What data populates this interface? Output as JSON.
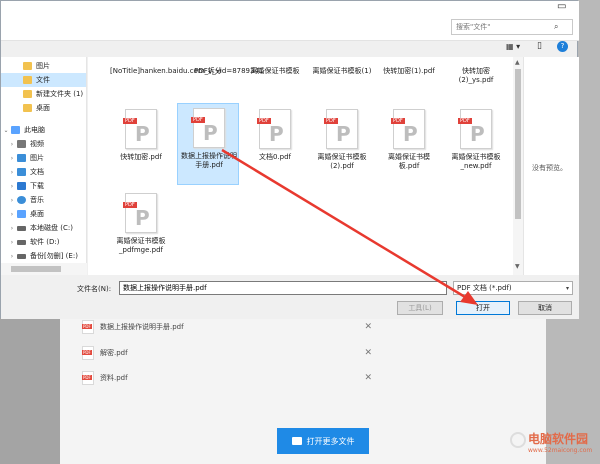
{
  "dialog": {
    "search_placeholder": "搜索\"文件\"",
    "nav": [
      {
        "label": "图片",
        "icon": "folder-icon"
      },
      {
        "label": "文件",
        "icon": "folder-icon",
        "selected": true
      },
      {
        "label": "新建文件夹 (1)",
        "icon": "folder-icon"
      },
      {
        "label": "桌面",
        "icon": "folder-icon"
      },
      {
        "label": "此电脑",
        "icon": "computer-icon"
      },
      {
        "label": "视频",
        "icon": "video-icon"
      },
      {
        "label": "图片",
        "icon": "picture-icon"
      },
      {
        "label": "文档",
        "icon": "document-icon"
      },
      {
        "label": "下载",
        "icon": "download-icon"
      },
      {
        "label": "音乐",
        "icon": "music-icon"
      },
      {
        "label": "桌面",
        "icon": "desktop-icon"
      },
      {
        "label": "本地磁盘 (C:)",
        "icon": "disk-icon"
      },
      {
        "label": "软件 (D:)",
        "icon": "disk-icon"
      },
      {
        "label": "备份[勿删] (E:)",
        "icon": "disk-icon"
      }
    ],
    "top_files": [
      "[NoTitle]hanken.baidu.com_v_vid=8789341",
      "PDF拆分",
      "离婚保证书模板",
      "离婚保证书模板(1)",
      "快转加密(1).pdf",
      "快转加密(2)_ys.pdf"
    ],
    "files": [
      "快转加密.pdf",
      "数据上报操作说明手册.pdf",
      "文档0.pdf",
      "离婚保证书模板(2).pdf",
      "离婚保证书模板.pdf",
      "离婚保证书模板_new.pdf",
      "离婚保证书模板_pdfmge.pdf"
    ],
    "preview_text": "没有预览。",
    "filename_label": "文件名(N):",
    "filename_value": "数据上报操作说明手册.pdf",
    "filetype_value": "PDF 文档 (*.pdf)",
    "tools_label": "工具(L)",
    "open_label": "打开",
    "cancel_label": "取消"
  },
  "background": {
    "recent_files": [
      "数据上报操作说明手册.pdf",
      "解密.pdf",
      "资料.pdf"
    ],
    "open_more_label": "打开更多文件"
  },
  "watermark": {
    "title": "电脑软件园",
    "url": "www.52maicong.com"
  },
  "colors": {
    "accent": "#1f8ae6",
    "selection": "#cce8ff",
    "arrow": "#e8392f",
    "pdf_tag": "#e0413a"
  }
}
